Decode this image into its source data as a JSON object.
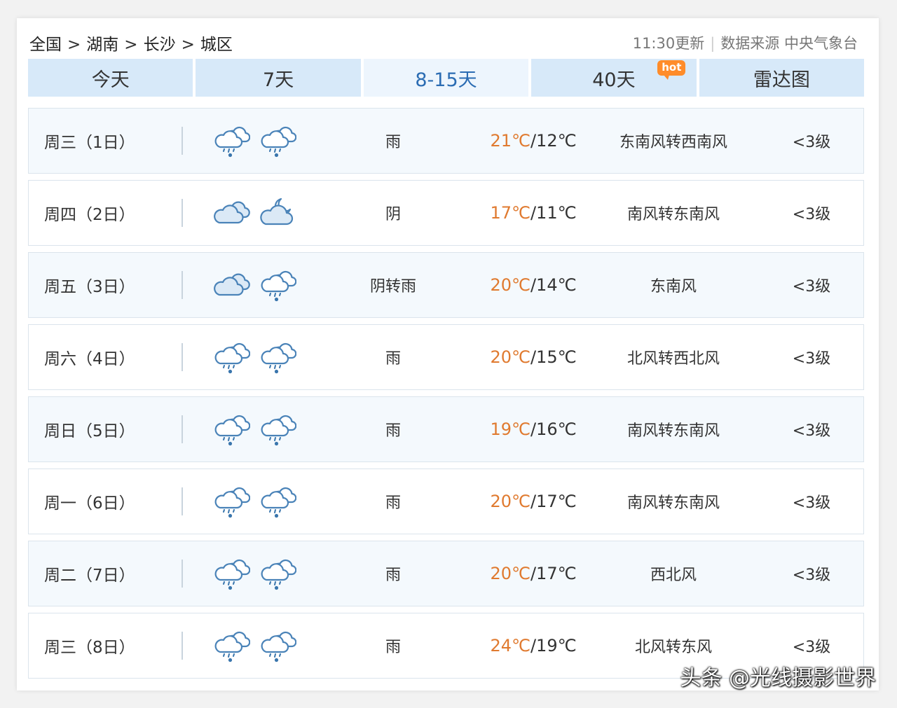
{
  "breadcrumb": [
    "全国",
    "湖南",
    "长沙",
    "城区"
  ],
  "breadcrumb_separator": ">",
  "update_time": "11:30更新",
  "data_source": "数据来源 中央气象台",
  "tabs": [
    {
      "label": "今天"
    },
    {
      "label": "7天"
    },
    {
      "label": "8-15天",
      "active": true
    },
    {
      "label": "40天",
      "badge": "hot"
    },
    {
      "label": "雷达图"
    }
  ],
  "colors": {
    "tab_bg": "#d7e9f9",
    "tab_active_bg": "#edf5fd",
    "tab_active_text": "#2b6cb3",
    "high_temp": "#e07a2f",
    "row_bg": "#f4f9fd",
    "hot_badge": "#ff8c2a",
    "icon_stroke": "#4a83b8"
  },
  "forecast": [
    {
      "day": "周三（1日）",
      "icons": [
        "rain-icon",
        "rain-icon"
      ],
      "desc": "雨",
      "high": "21℃",
      "low": "12℃",
      "wind": "东南风转西南风",
      "level": "<3级"
    },
    {
      "day": "周四（2日）",
      "icons": [
        "cloudy-icon",
        "partly-cloudy-night-icon"
      ],
      "desc": "阴",
      "high": "17℃",
      "low": "11℃",
      "wind": "南风转东南风",
      "level": "<3级"
    },
    {
      "day": "周五（3日）",
      "icons": [
        "cloudy-icon",
        "rain-icon"
      ],
      "desc": "阴转雨",
      "high": "20℃",
      "low": "14℃",
      "wind": "东南风",
      "level": "<3级"
    },
    {
      "day": "周六（4日）",
      "icons": [
        "rain-icon",
        "rain-icon"
      ],
      "desc": "雨",
      "high": "20℃",
      "low": "15℃",
      "wind": "北风转西北风",
      "level": "<3级"
    },
    {
      "day": "周日（5日）",
      "icons": [
        "rain-icon",
        "rain-icon"
      ],
      "desc": "雨",
      "high": "19℃",
      "low": "16℃",
      "wind": "南风转东南风",
      "level": "<3级"
    },
    {
      "day": "周一（6日）",
      "icons": [
        "rain-icon",
        "rain-icon"
      ],
      "desc": "雨",
      "high": "20℃",
      "low": "17℃",
      "wind": "南风转东南风",
      "level": "<3级"
    },
    {
      "day": "周二（7日）",
      "icons": [
        "rain-icon",
        "rain-icon"
      ],
      "desc": "雨",
      "high": "20℃",
      "low": "17℃",
      "wind": "西北风",
      "level": "<3级"
    },
    {
      "day": "周三（8日）",
      "icons": [
        "rain-icon",
        "rain-icon"
      ],
      "desc": "雨",
      "high": "24℃",
      "low": "19℃",
      "wind": "北风转东风",
      "level": "<3级"
    }
  ],
  "watermark": "头条 @光线摄影世界"
}
